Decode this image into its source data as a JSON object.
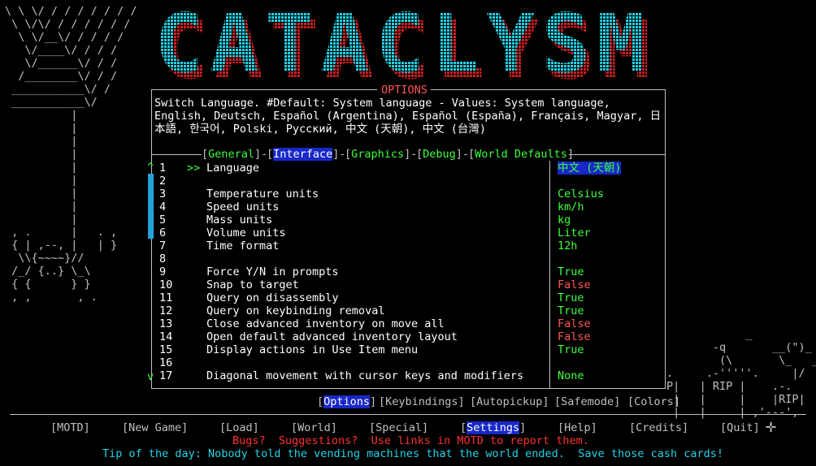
{
  "banner": {
    "text": "CATACLYSM",
    "colors": {
      "cyan": "#22d3e8",
      "red": "#d02020"
    }
  },
  "options_title": "OPTIONS",
  "description": "Switch Language. #Default: System language - Values: System language, English, Deutsch, Español (Argentina), Español (España), Français, Magyar, 日本語, 한국어, Polski, Русский, 中文 (天朝), 中文 (台灣)",
  "tabs": [
    {
      "label": "General",
      "active": false
    },
    {
      "label": "Interface",
      "active": true
    },
    {
      "label": "Graphics",
      "active": false
    },
    {
      "label": "Debug",
      "active": false
    },
    {
      "label": "World Defaults",
      "active": false
    }
  ],
  "scroll": {
    "up": "^",
    "down": "v"
  },
  "options": [
    {
      "num": "1",
      "name": "Language",
      "value": "中文 (天朝)",
      "style": "sel",
      "cursor": ">>"
    },
    {
      "num": "2",
      "name": "",
      "value": "",
      "style": ""
    },
    {
      "num": "3",
      "name": "Temperature units",
      "value": "Celsius",
      "style": "green"
    },
    {
      "num": "4",
      "name": "Speed units",
      "value": "km/h",
      "style": "green"
    },
    {
      "num": "5",
      "name": "Mass units",
      "value": "kg",
      "style": "green"
    },
    {
      "num": "6",
      "name": "Volume units",
      "value": "Liter",
      "style": "green"
    },
    {
      "num": "7",
      "name": "Time format",
      "value": "12h",
      "style": "green"
    },
    {
      "num": "8",
      "name": "",
      "value": "",
      "style": ""
    },
    {
      "num": "9",
      "name": "Force Y/N in prompts",
      "value": "True",
      "style": "green"
    },
    {
      "num": "10",
      "name": "Snap to target",
      "value": "False",
      "style": "red"
    },
    {
      "num": "11",
      "name": "Query on disassembly",
      "value": "True",
      "style": "green"
    },
    {
      "num": "12",
      "name": "Query on keybinding removal",
      "value": "True",
      "style": "green"
    },
    {
      "num": "13",
      "name": "Close advanced inventory on move all",
      "value": "False",
      "style": "red"
    },
    {
      "num": "14",
      "name": "Open default advanced inventory layout",
      "value": "False",
      "style": "red"
    },
    {
      "num": "15",
      "name": "Display actions in Use Item menu",
      "value": "True",
      "style": "green"
    },
    {
      "num": "16",
      "name": "",
      "value": "",
      "style": ""
    },
    {
      "num": "17",
      "name": "Diagonal movement with cursor keys and modifiers",
      "value": "None",
      "style": "green"
    }
  ],
  "submenu": [
    {
      "label": "Options",
      "active": true
    },
    {
      "label": "Keybindings",
      "active": false
    },
    {
      "label": "Autopickup",
      "active": false
    },
    {
      "label": "Safemode",
      "active": false
    },
    {
      "label": "Colors",
      "active": false
    }
  ],
  "mainmenu": [
    {
      "label": "MOTD",
      "active": false
    },
    {
      "label": "New Game",
      "active": false
    },
    {
      "label": "Load",
      "active": false
    },
    {
      "label": "World",
      "active": false
    },
    {
      "label": "Special",
      "active": false
    },
    {
      "label": "Settings",
      "active": true
    },
    {
      "label": "Help",
      "active": false
    },
    {
      "label": "Credits",
      "active": false
    },
    {
      "label": "Quit",
      "active": false
    }
  ],
  "bugs_line": "Bugs?  Suggestions?  Use links in MOTD to report them.",
  "tip_line": "Tip of the day: Nobody told the vending machines that the world ended.  Save those cash cards!",
  "left_art": "\\ \\ \\/ / / / / / / /\n \\ \\/\\/ / / / / / /\n  \\ \\/__\\/ / / / /\n   \\/____\\/ / / /\n   \\/______\\/ / /\n  /________\\/ / /\n ___________\\/ /\n ___________\\/\n          |\n          |\n          |\n          |\n          |\n          |\n          |\n          |\n          |\n , .      |   . ,\n { | ,--, |   | }\n  \\\\{~~~~}//\n /_/ {..} \\_\\\n { {      } }\n , ,       , .",
  "rip_art": "            _\n       -q       __(\")_\n        (\\       \\_   _/\n.     .-'''''.     |/\nP|   | RIP |    .-.\n |   |     |    |RIP|\n |   |     | ,'---',"
}
